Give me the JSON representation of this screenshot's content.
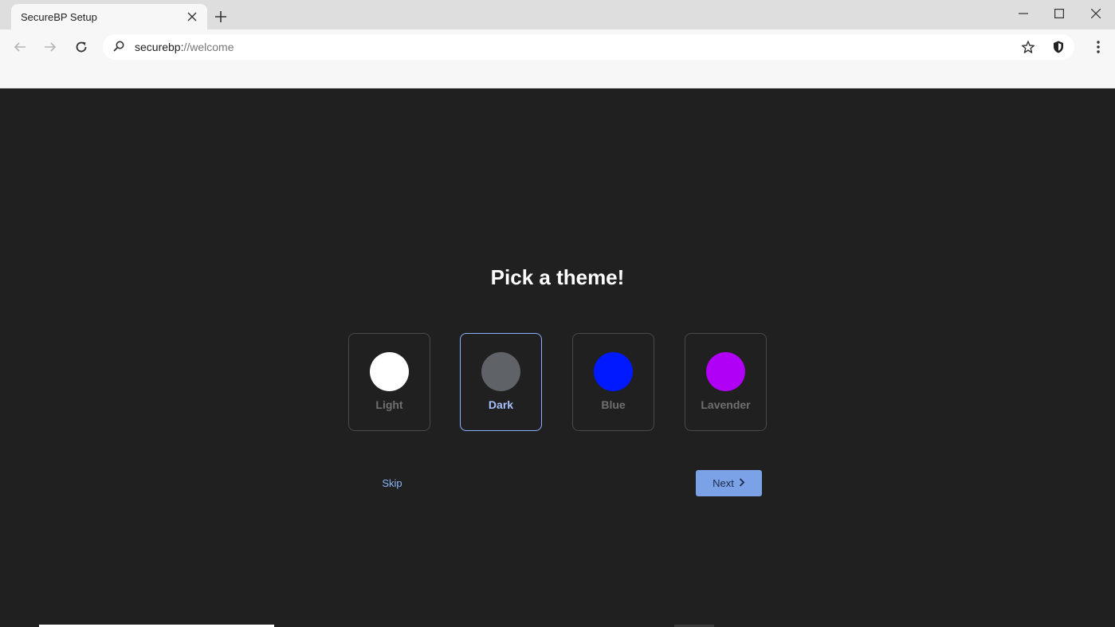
{
  "browser": {
    "tab_title": "SecureBP Setup",
    "url_host": "securebp:",
    "url_path": "//welcome"
  },
  "page": {
    "title": "Pick a theme!",
    "themes": [
      {
        "label": "Light",
        "color": "#ffffff",
        "selected": false
      },
      {
        "label": "Dark",
        "color": "#5f6368",
        "selected": true
      },
      {
        "label": "Blue",
        "color": "#0019ff",
        "selected": false
      },
      {
        "label": "Lavender",
        "color": "#b000f5",
        "selected": false
      }
    ],
    "skip_label": "Skip",
    "next_label": "Next"
  },
  "colors": {
    "page_bg": "#202020",
    "accent": "#8ab4f8",
    "next_button_bg": "#7ba2e6"
  },
  "icons": [
    "close-icon",
    "plus-icon",
    "minimize-icon",
    "maximize-icon",
    "window-close-icon",
    "back-icon",
    "forward-icon",
    "reload-icon",
    "search-icon",
    "star-icon",
    "shield-icon",
    "kebab-menu-icon",
    "chevron-right-icon"
  ]
}
